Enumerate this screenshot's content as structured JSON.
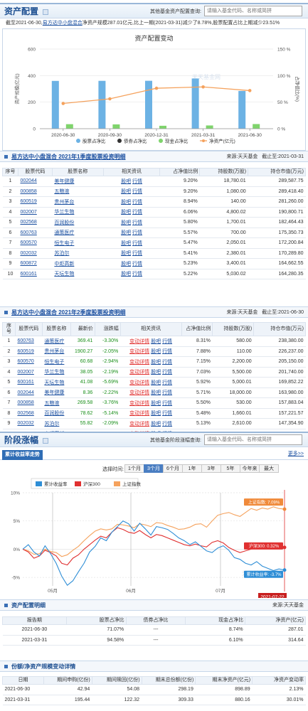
{
  "asset": {
    "title": "资产配置",
    "query_label": "其他基金资产配置查询:",
    "query_placeholder": "请输入基金代码、名称或简拼",
    "info_pre": "截至2021-06-30,",
    "fund_name": "易方达中小盘混合",
    "info_post": "净资产规模287.01亿元,比上一期(2021-03-31)减少了8.78%,股票配置占比上期减少23.51%",
    "chart_title": "资产配置变动",
    "watermark": "天天基金网"
  },
  "chart_data": {
    "type": "bar",
    "categories": [
      "2020-06-30",
      "2020-09-30",
      "2020-12-31",
      "2021-03-31",
      "2021-06-30"
    ],
    "ylabel": "资产规模(亿元)",
    "y2label": "占净值比(%)",
    "ylim": [
      0,
      600
    ],
    "y2lim": [
      0,
      150
    ],
    "yticks": [
      "0",
      "200",
      "400",
      "600"
    ],
    "y2ticks": [
      "0 %",
      "50 %",
      "100 %",
      "150 %"
    ],
    "series": [
      {
        "name": "股票占净比",
        "color": "#6cb2e4",
        "values": [
          90.01,
          90.12,
          90.23,
          94.58,
          71.07
        ]
      },
      {
        "name": "债券占净比",
        "color": "#333333",
        "values": [
          0,
          0,
          0,
          0,
          0
        ]
      },
      {
        "name": "现金占净比",
        "color": "#7fd46c",
        "values": [
          8.5,
          8.1,
          5.5,
          6.1,
          8.74
        ]
      },
      {
        "name": "净资产(亿元)",
        "color": "#f5a25d",
        "values": [
          190,
          225,
          305,
          314.64,
          287.01
        ]
      }
    ]
  },
  "holdings1": {
    "title": "易方达中小盘混合  2021年1季度股票投资明细",
    "source": "来源:天天基金",
    "date": "截止至:2021-03-31",
    "headers": [
      "序号",
      "股票代码",
      "股票名称",
      "相关资讯",
      "占净值比例",
      "持股数(万股)",
      "持仓市值(万元)"
    ],
    "rows": [
      [
        "1",
        "002044",
        "美年健康",
        "股吧 行情",
        "9.20%",
        "18,780.01",
        "289,587.75"
      ],
      [
        "2",
        "000858",
        "五粮液",
        "股吧 行情",
        "9.20%",
        "1,080.00",
        "289,418.40"
      ],
      [
        "3",
        "600519",
        "贵州茅台",
        "股吧 行情",
        "8.94%",
        "140.00",
        "281,260.00"
      ],
      [
        "4",
        "002007",
        "华兰生物",
        "股吧 行情",
        "6.06%",
        "4,800.02",
        "190,800.71"
      ],
      [
        "5",
        "002568",
        "百润股份",
        "股吧 行情",
        "5.80%",
        "1,700.01",
        "182,464.43"
      ],
      [
        "6",
        "600763",
        "通策医疗",
        "股吧 行情",
        "5.57%",
        "700.00",
        "175,350.73"
      ],
      [
        "7",
        "600570",
        "恒生电子",
        "股吧 行情",
        "5.47%",
        "2,050.01",
        "172,200.84"
      ],
      [
        "8",
        "002032",
        "苏泊尔",
        "股吧 行情",
        "5.41%",
        "2,380.01",
        "170,289.80"
      ],
      [
        "9",
        "600872",
        "中炬高新",
        "股吧 行情",
        "5.23%",
        "3,400.01",
        "164,662.55"
      ],
      [
        "10",
        "600161",
        "天坛生物",
        "股吧 行情",
        "5.22%",
        "5,030.02",
        "164,280.35"
      ]
    ]
  },
  "holdings2": {
    "title": "易方达中小盘混合  2021年2季度股票投资明细",
    "source": "来源:天天基金",
    "date": "截止至:2021-06-30",
    "headers": [
      "序号",
      "股票代码",
      "股票名称",
      "最新价",
      "涨跌幅",
      "相关资讯",
      "占净值比例",
      "持股数(万股)",
      "持仓市值(万元)"
    ],
    "rows": [
      [
        "1",
        "600763",
        "通策医疗",
        "369.41",
        "-3.30%",
        "变动详情 股吧 行情",
        "8.31%",
        "580.00",
        "238,380.00"
      ],
      [
        "2",
        "600519",
        "贵州茅台",
        "1900.27",
        "-2.05%",
        "变动详情 股吧 行情",
        "7.88%",
        "110.00",
        "226,237.00"
      ],
      [
        "3",
        "600570",
        "恒生电子",
        "60.68",
        "-2.94%",
        "变动详情 股吧 行情",
        "7.15%",
        "2,200.00",
        "205,150.00"
      ],
      [
        "4",
        "002007",
        "华兰生物",
        "38.05",
        "-2.19%",
        "变动详情 股吧 行情",
        "7.03%",
        "5,500.00",
        "201,740.00"
      ],
      [
        "5",
        "600161",
        "天坛生物",
        "41.08",
        "-5.69%",
        "变动详情 股吧 行情",
        "5.92%",
        "5,000.01",
        "169,852.22"
      ],
      [
        "6",
        "002044",
        "美年健康",
        "8.36",
        "-2.22%",
        "变动详情 股吧 行情",
        "5.71%",
        "18,000.00",
        "163,980.00"
      ],
      [
        "7",
        "000858",
        "五粮液",
        "269.58",
        "-3.76%",
        "变动详情 股吧 行情",
        "5.50%",
        "530.00",
        "157,883.04"
      ],
      [
        "8",
        "002568",
        "百润股份",
        "78.62",
        "-5.14%",
        "变动详情 股吧 行情",
        "5.48%",
        "1,660.01",
        "157,221.57"
      ],
      [
        "9",
        "002032",
        "苏泊尔",
        "55.82",
        "-2.09%",
        "变动详情 股吧 行情",
        "5.13%",
        "2,610.00",
        "147,354.90"
      ],
      [
        "10",
        "600872",
        "中炬高新",
        "37.81",
        "3.05%",
        "变动详情 股吧 行情",
        "4.98%",
        "3,400.01",
        "142,868.48"
      ]
    ]
  },
  "perf": {
    "title": "阶段涨幅",
    "query_label": "其他基金阶段涨幅查询:",
    "query_placeholder": "请输入基金代码、名称或简拼",
    "tab": "累计收益率走势",
    "more": "更多>>",
    "range_label": "选择时间:",
    "ranges": [
      "1个月",
      "3个月",
      "6个月",
      "1年",
      "3年",
      "5年",
      "今年来",
      "最大"
    ],
    "active_range": "3个月",
    "legend": [
      "累计收益率",
      "沪深300",
      "上证指数"
    ],
    "yticks": [
      "10%",
      "5%",
      "0%",
      "-5%"
    ],
    "xticks": [
      "05月",
      "06月",
      "07月"
    ],
    "tag_shanghai": "上证指数: 7.09%",
    "tag_hs300": "沪深300: 0.32%",
    "tag_fund": "累计收益率: -3.7%",
    "date_tag": "2021-07-22",
    "watermark": "天天基金网"
  },
  "perf_chart": {
    "type": "line",
    "series": [
      {
        "name": "累计收益率",
        "color": "#2f8ed6",
        "values": [
          0,
          0.8,
          -0.5,
          -1.2,
          0.6,
          -0.8,
          -2.5,
          -4.8,
          -6.4,
          -5.6,
          -4,
          -2.5,
          -0.5,
          0.5,
          2,
          1.5,
          3,
          4,
          5,
          4.5,
          3.2,
          4.6,
          3.6,
          2.5,
          4,
          3.8,
          3.5,
          2.8,
          2,
          1.5,
          0.8,
          1.3,
          0.5,
          -0.3,
          -0.6,
          0.2,
          0.6,
          -0.2,
          -1.5,
          -1.8,
          -2.5,
          -2.8,
          -2.2,
          -3,
          -3.4,
          -3.8,
          -3.5,
          -3.7
        ]
      },
      {
        "name": "沪深300",
        "color": "#e03030",
        "values": [
          0,
          -0.5,
          -1.6,
          -1.2,
          -0.2,
          -0.6,
          -1.2,
          -2.5,
          -2.8,
          -1.6,
          -1,
          0,
          0.8,
          1.6,
          2.3,
          2,
          3,
          3.8,
          3.5,
          3,
          2.8,
          3.3,
          2.6,
          2,
          2.6,
          2.4,
          2,
          1.6,
          1.2,
          0.8,
          0.6,
          0.9,
          0.6,
          0.4,
          1.2,
          1.5,
          1.1,
          0.3,
          -0.2,
          -0.6,
          -0.3,
          0,
          0.4,
          0.2,
          0.5,
          0.3,
          0.2,
          0.32
        ]
      },
      {
        "name": "上证指数",
        "color": "#f5a25d",
        "values": [
          0,
          -0.3,
          -0.9,
          -0.8,
          0,
          -0.4,
          -0.6,
          -1.3,
          -1,
          -0.2,
          0.5,
          1.5,
          2.4,
          3.2,
          3.6,
          3.4,
          3.6,
          4.4,
          4.3,
          4.1,
          3.8,
          4.5,
          4.3,
          4,
          4.7,
          4.6,
          4.2,
          3.9,
          3.5,
          3.6,
          3.9,
          4.4,
          4.5,
          3.9,
          5,
          6,
          6.3,
          6.5,
          6.1,
          5.8,
          6.5,
          7.2,
          6.9,
          7.3,
          7.1,
          7.5,
          7.2,
          7.09
        ]
      }
    ]
  },
  "alloc": {
    "title": "资产配置明细",
    "source": "来源:天天基金",
    "headers": [
      "报告期",
      "股票占净比",
      "债券占净比",
      "现金占净比",
      "净资产(亿元)"
    ],
    "rows": [
      [
        "2021-06-30",
        "71.07%",
        "---",
        "8.74%",
        "287.01"
      ],
      [
        "2021-03-31",
        "94.58%",
        "---",
        "6.10%",
        "314.64"
      ]
    ]
  },
  "scale": {
    "title": "份额/净资产规模变动详情",
    "headers": [
      "日期",
      "期间申购(亿份)",
      "期间赎回(亿份)",
      "期末总份额(亿份)",
      "期末净资产(亿元)",
      "净资产变动率"
    ],
    "rows": [
      [
        "2021-06-30",
        "42.94",
        "54.08",
        "298.19",
        "898.89",
        "2.13%"
      ],
      [
        "2021-03-31",
        "195.44",
        "122.32",
        "309.33",
        "880.16",
        "30.01%"
      ]
    ]
  }
}
